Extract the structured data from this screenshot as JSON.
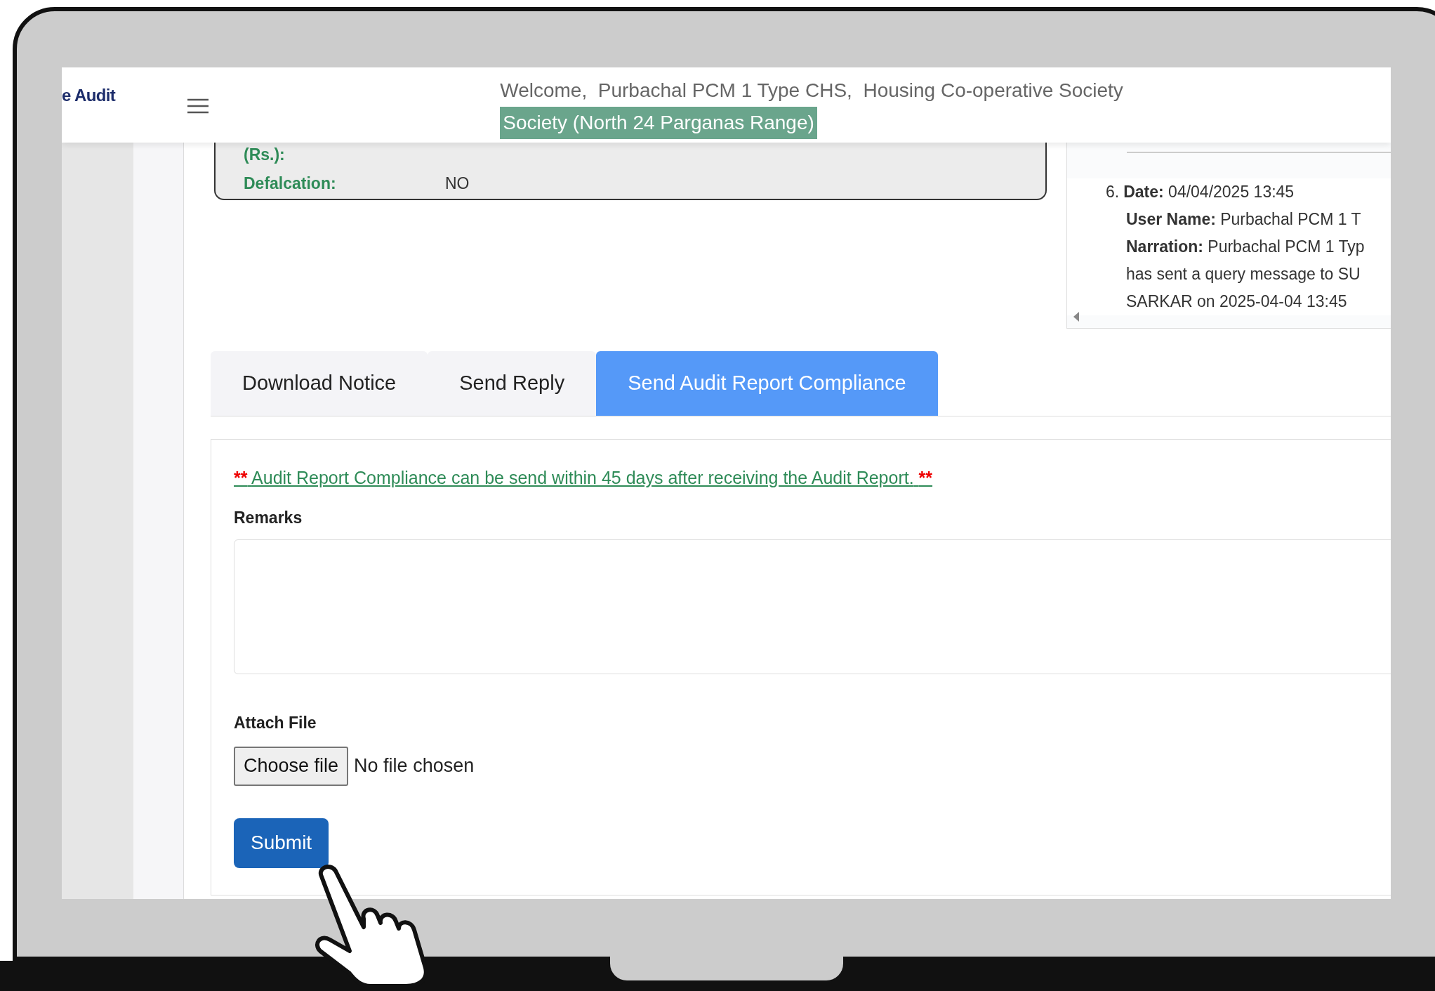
{
  "header": {
    "logo": "e Audit",
    "welcome": "Welcome,  Purbachal PCM 1 Type CHS,  Housing Co-operative Society",
    "range_badge": "Society (North 24 Parganas Range)"
  },
  "summary_card": {
    "rows": [
      {
        "label": "(Rs.):"
      },
      {
        "label": "Defalcation:",
        "value": "NO"
      }
    ]
  },
  "activity_log": {
    "entries": [
      {
        "number": "6.",
        "date_label": "Date:",
        "date": "04/04/2025 13:45",
        "user_label": "User Name:",
        "user": "Purbachal PCM 1 T",
        "narration_label": "Narration:",
        "narration": [
          "Purbachal PCM 1 Typ",
          "has sent a query message to SU",
          "SARKAR on 2025-04-04 13:45"
        ]
      }
    ]
  },
  "tabs": [
    {
      "label": "Download Notice",
      "selected": false
    },
    {
      "label": "Send Reply",
      "selected": false
    },
    {
      "label": "Send Audit Report Compliance",
      "selected": true
    }
  ],
  "form": {
    "notice": {
      "mark_before": "**",
      "text": "Audit Report Compliance can be send within 45 days after receiving the Audit Report.",
      "mark_after": "**"
    },
    "remarks": {
      "label": "Remarks"
    },
    "attach": {
      "label": "Attach File",
      "button": "Choose file",
      "status": "No file chosen"
    },
    "submit": "Submit"
  }
}
